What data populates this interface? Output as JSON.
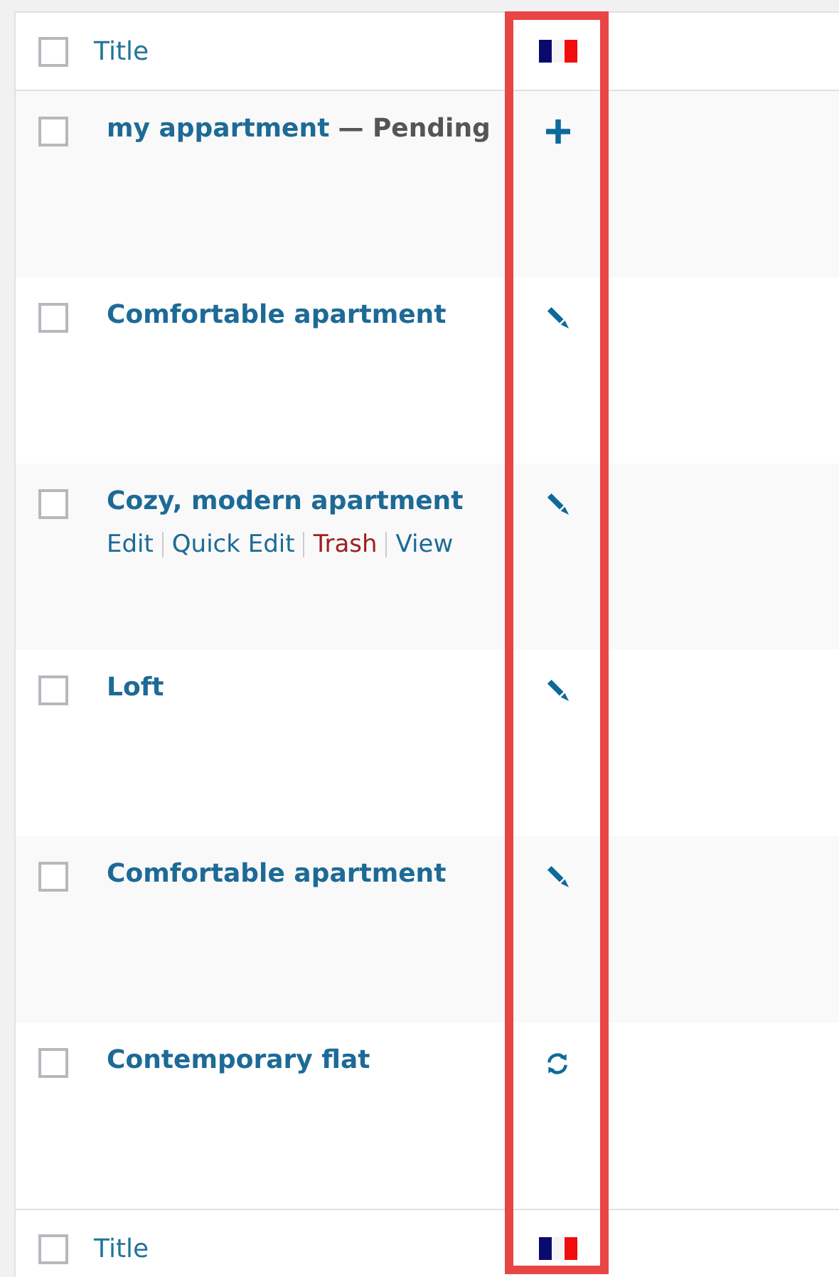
{
  "header": {
    "checked": false,
    "title": "Title",
    "language": {
      "kind": "flag"
    }
  },
  "rows": [
    {
      "title": "my appartment",
      "status": "— Pending",
      "translation": {
        "kind": "add"
      },
      "checked": false
    },
    {
      "title": "Comfortable apartment",
      "translation": {
        "kind": "edit"
      },
      "checked": false
    },
    {
      "title": "Cozy, modern apartment",
      "translation": {
        "kind": "edit"
      },
      "checked": false,
      "actions": [
        {
          "label": "Edit",
          "kind": "link"
        },
        {
          "label": "Quick Edit",
          "kind": "link"
        },
        {
          "label": "Trash",
          "kind": "delete"
        },
        {
          "label": "View",
          "kind": "link"
        }
      ]
    },
    {
      "title": "Loft",
      "translation": {
        "kind": "edit"
      },
      "checked": false
    },
    {
      "title": "Comfortable apartment",
      "translation": {
        "kind": "edit"
      },
      "checked": false
    },
    {
      "title": "Contemporary flat",
      "translation": {
        "kind": "sync"
      },
      "checked": false
    }
  ],
  "footer": {
    "checked": false,
    "title": "Title",
    "language": {
      "kind": "flag"
    }
  }
}
